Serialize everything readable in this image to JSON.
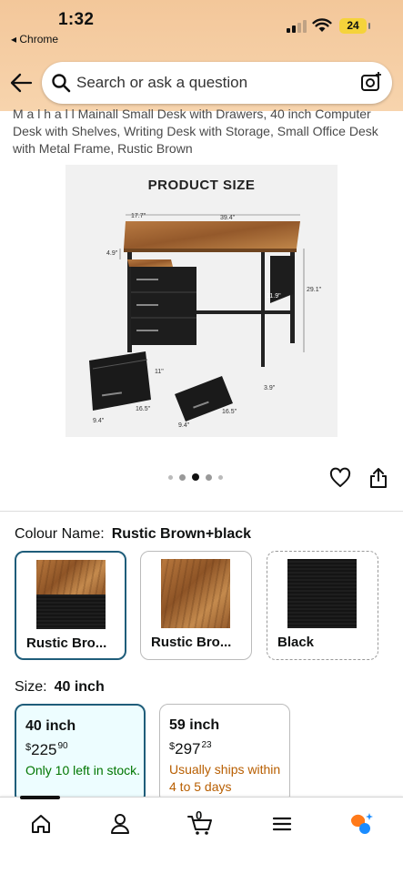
{
  "status_bar": {
    "time": "1:32",
    "back_app": "Chrome",
    "battery": "24"
  },
  "search": {
    "placeholder": "Search or ask a question"
  },
  "product": {
    "title": "M a  l  h  a  l  l  Mainall Small Desk with Drawers, 40 inch Computer Desk with Shelves, Writing Desk with Storage, Small Office Desk with Metal Frame, Rustic Brown",
    "image": {
      "heading": "PRODUCT SIZE",
      "dimensions": [
        "17.7\"",
        "39.4\"",
        "4.9\"",
        "29.1\"",
        "11.9\"",
        "11\"",
        "3.9\"",
        "9.4\"",
        "16.5\"",
        "9.4\"",
        "16.5\""
      ]
    },
    "image_dots": {
      "count": 5,
      "active_index": 2
    }
  },
  "colour": {
    "label": "Colour Name:",
    "selected": "Rustic Brown+black",
    "options": [
      {
        "label": "Rustic Bro...",
        "swatch": "wood-black",
        "state": "selected"
      },
      {
        "label": "Rustic Bro...",
        "swatch": "wood",
        "state": "available"
      },
      {
        "label": "Black",
        "swatch": "black",
        "state": "unavailable"
      }
    ]
  },
  "size": {
    "label": "Size:",
    "selected": "40 inch",
    "options": [
      {
        "name": "40 inch",
        "currency": "$",
        "price_whole": "225",
        "price_fraction": "90",
        "availability": "Only 10 left in stock.",
        "availability_color": "#007600",
        "state": "selected"
      },
      {
        "name": "59 inch",
        "currency": "$",
        "price_whole": "297",
        "price_fraction": "23",
        "availability": "Usually ships within 4 to 5 days",
        "availability_color": "#b85e00",
        "state": "available"
      }
    ]
  },
  "bottom_nav": {
    "items": [
      "home-icon",
      "account-icon",
      "cart-icon",
      "menu-icon",
      "rufus-assistant-icon"
    ],
    "cart_count": "0"
  },
  "colors": {
    "header": "#f3c79a",
    "selected_border": "#1f5d7a",
    "in_stock": "#007600",
    "shipping": "#b85e00",
    "battery": "#f5d33b"
  }
}
